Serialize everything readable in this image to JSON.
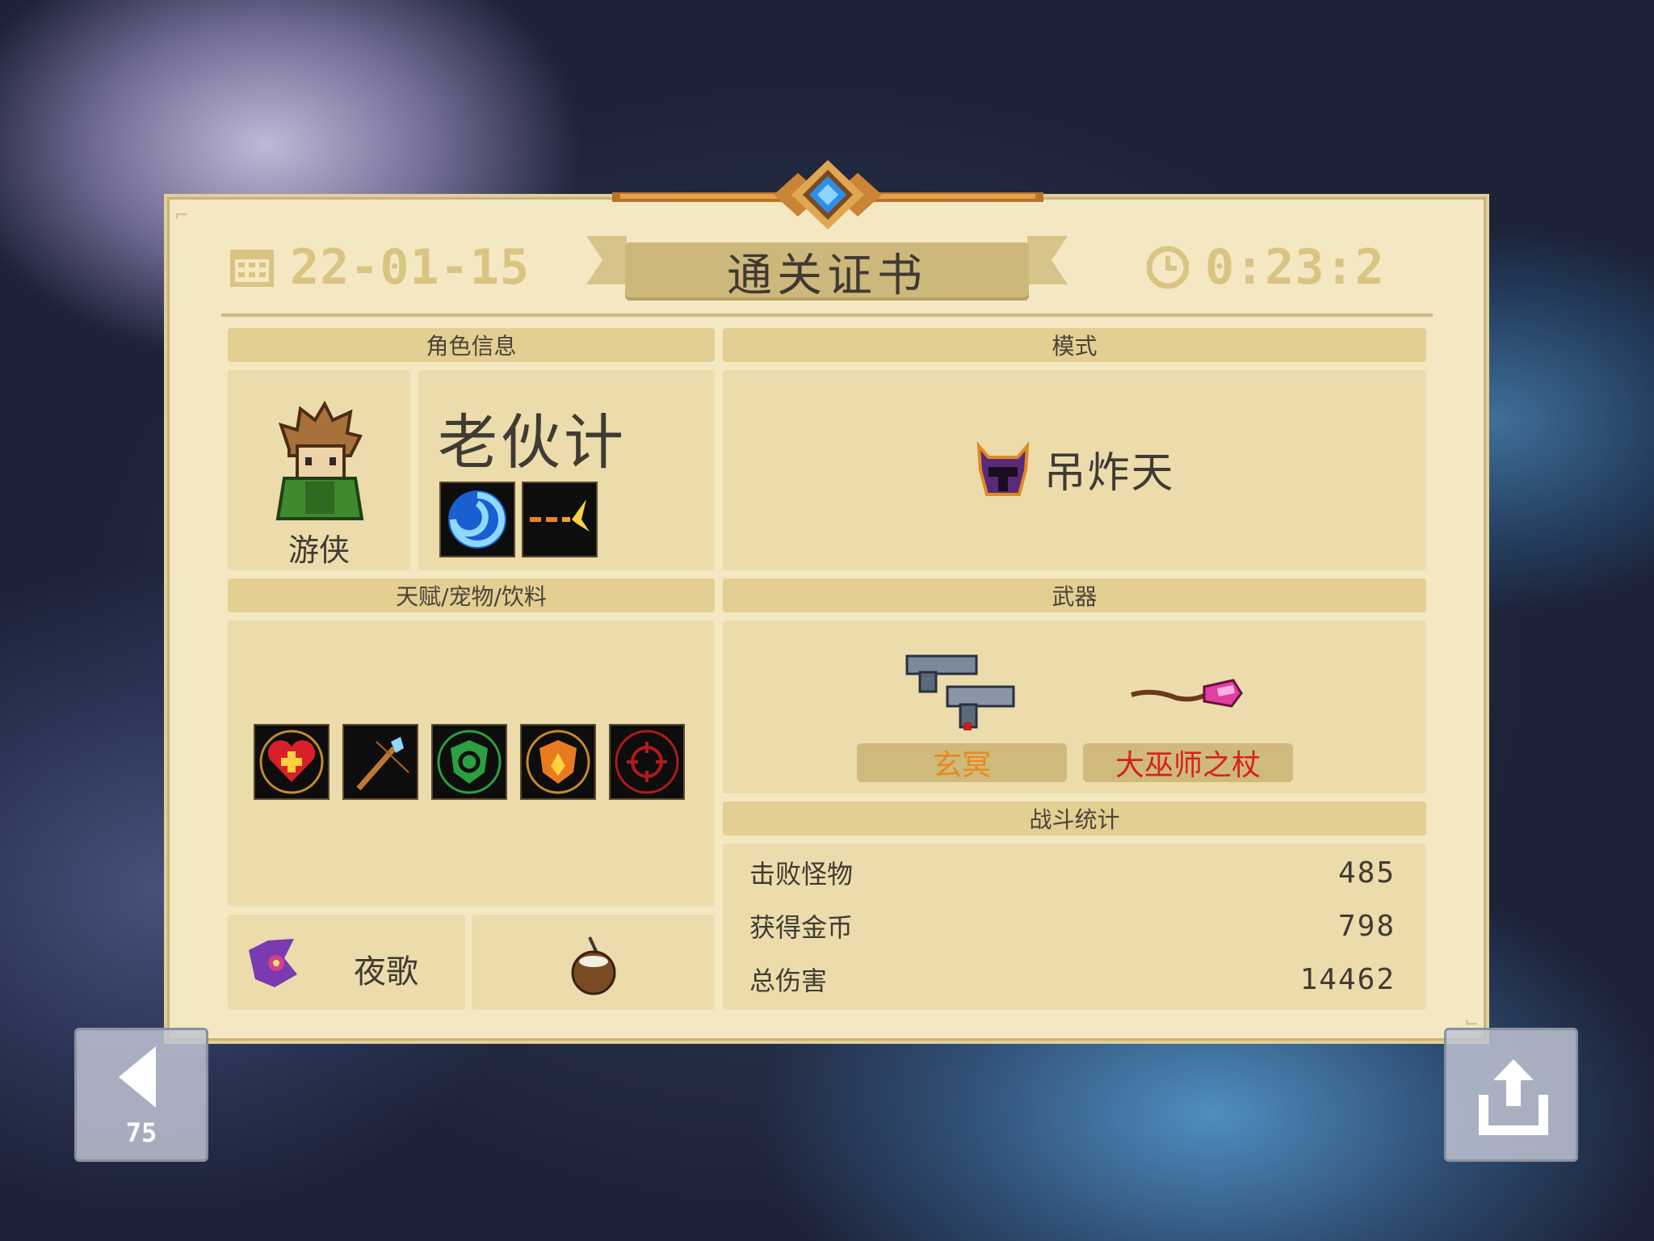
{
  "header": {
    "date": "22-01-15",
    "title": "通关证书",
    "time": "0:23:2"
  },
  "sections": {
    "character": "角色信息",
    "mode": "模式",
    "talents": "天赋/宠物/饮料",
    "weapons": "武器",
    "stats": "战斗统计"
  },
  "character": {
    "class_name": "游侠",
    "skin_name": "老伙计",
    "skills": [
      "swirl-skill-icon",
      "bullet-skill-icon"
    ]
  },
  "mode": {
    "icon": "horned-helmet-icon",
    "name": "吊炸天"
  },
  "talents": [
    "heart-plus-icon",
    "magic-staff-icon",
    "green-shield-icon",
    "fire-shield-icon",
    "crosshair-icon"
  ],
  "pet": {
    "name": "夜歌",
    "icon": "purple-bird-icon"
  },
  "drink": {
    "icon": "coconut-drink-icon"
  },
  "weapons": [
    {
      "name": "玄冥",
      "color": "#e88a1a",
      "icon": "dual-pistols-icon"
    },
    {
      "name": "大巫师之杖",
      "color": "#d8201c",
      "icon": "crystal-staff-icon"
    }
  ],
  "stats": [
    {
      "label": "击败怪物",
      "value": "485"
    },
    {
      "label": "获得金币",
      "value": "798"
    },
    {
      "label": "总伤害",
      "value": "14462"
    }
  ],
  "nav": {
    "back_count": "75"
  },
  "colors": {
    "panel": "#f4e8c2",
    "section_header": "#e3cf92",
    "header_text": "#d9c483"
  }
}
